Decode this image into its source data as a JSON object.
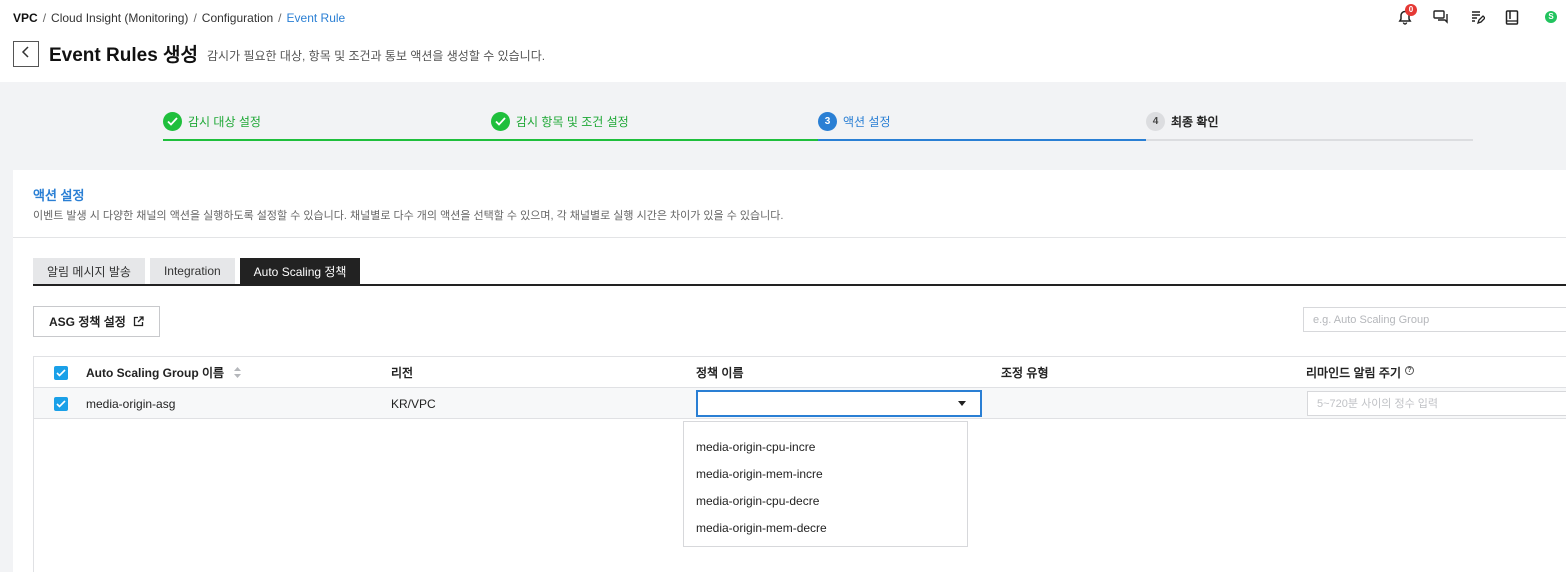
{
  "breadcrumb": {
    "items": [
      "VPC",
      "Cloud Insight (Monitoring)",
      "Configuration",
      "Event Rule"
    ],
    "separator": "/"
  },
  "header": {
    "title": "Event Rules 생성",
    "description": "감시가 필요한 대상, 항목 및 조건과 통보 액션을 생성할 수 있습니다.",
    "notification_count": "0",
    "avatar_initial": "S",
    "icons": [
      "bell-icon",
      "chat-icon",
      "edit-note-icon",
      "book-icon"
    ]
  },
  "stepper": {
    "steps": [
      {
        "number": "1",
        "label": "감시 대상 설정",
        "state": "done"
      },
      {
        "number": "2",
        "label": "감시 항목 및 조건 설정",
        "state": "done"
      },
      {
        "number": "3",
        "label": "액션 설정",
        "state": "active"
      },
      {
        "number": "4",
        "label": "최종 확인",
        "state": "pending"
      }
    ]
  },
  "section": {
    "title": "액션 설정",
    "description": "이벤트 발생 시 다양한 채널의 액션을 실행하도록 설정할 수 있습니다. 채널별로 다수 개의 액션을 선택할 수 있으며, 각 채널별로 실행 시간은 차이가 있을 수 있습니다."
  },
  "tabs": [
    {
      "label": "알림 메시지 발송",
      "active": false
    },
    {
      "label": "Integration",
      "active": false
    },
    {
      "label": "Auto Scaling 정책",
      "active": true
    }
  ],
  "asg_button": {
    "label": "ASG 정책 설정"
  },
  "search": {
    "placeholder": "e.g. Auto Scaling Group",
    "value": ""
  },
  "table": {
    "columns": [
      "Auto Scaling Group 이름",
      "리전",
      "정책 이름",
      "조정 유형",
      "리마인드 알림 주기"
    ],
    "rows": [
      {
        "checked": true,
        "name": "media-origin-asg",
        "region": "KR/VPC",
        "policy": "",
        "adjust_type": "",
        "remind_placeholder": "5~720분 사이의 정수 입력"
      }
    ],
    "header_checked": true
  },
  "policy_dropdown": {
    "open": true,
    "options": [
      "media-origin-cpu-incre",
      "media-origin-mem-incre",
      "media-origin-cpu-decre",
      "media-origin-mem-decre"
    ]
  },
  "colors": {
    "accent": "#2a7fd4",
    "done": "#1fbf3c",
    "checkbox": "#1aa0e8",
    "badge": "#e53935",
    "avatar": "#22c35e"
  }
}
